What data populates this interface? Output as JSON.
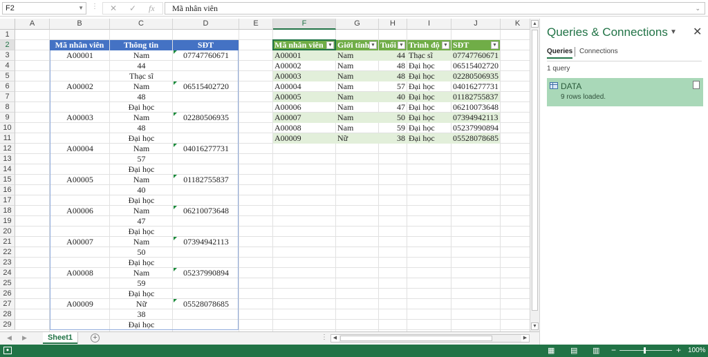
{
  "formula_bar": {
    "name_box": "F2",
    "more_icon": "⋮",
    "cancel_icon": "✕",
    "enter_icon": "✓",
    "fx_icon": "fx",
    "content": "Mã nhân viên"
  },
  "columns": [
    "A",
    "B",
    "C",
    "D",
    "E",
    "F",
    "G",
    "H",
    "I",
    "J",
    "K"
  ],
  "selected_column": "F",
  "rows": [
    "1",
    "2",
    "3",
    "4",
    "5",
    "6",
    "7",
    "8",
    "9",
    "10",
    "11",
    "12",
    "13",
    "14",
    "15",
    "16",
    "17",
    "18",
    "19",
    "20",
    "21",
    "22",
    "23",
    "24",
    "25",
    "26",
    "27",
    "28",
    "29"
  ],
  "selected_row": "2",
  "left_table": {
    "headers": [
      "Mã nhân viên",
      "Thông tin",
      "SĐT"
    ],
    "records": [
      {
        "id": "A00001",
        "gender": "Nam",
        "age": "44",
        "level": "Thạc sĩ",
        "phone": "07747760671"
      },
      {
        "id": "A00002",
        "gender": "Nam",
        "age": "48",
        "level": "Đại học",
        "phone": "06515402720"
      },
      {
        "id": "A00003",
        "gender": "Nam",
        "age": "48",
        "level": "Đại học",
        "phone": "02280506935"
      },
      {
        "id": "A00004",
        "gender": "Nam",
        "age": "57",
        "level": "Đại học",
        "phone": "04016277731"
      },
      {
        "id": "A00005",
        "gender": "Nam",
        "age": "40",
        "level": "Đại học",
        "phone": "01182755837"
      },
      {
        "id": "A00006",
        "gender": "Nam",
        "age": "47",
        "level": "Đại học",
        "phone": "06210073648"
      },
      {
        "id": "A00007",
        "gender": "Nam",
        "age": "50",
        "level": "Đại học",
        "phone": "07394942113"
      },
      {
        "id": "A00008",
        "gender": "Nam",
        "age": "59",
        "level": "Đại học",
        "phone": "05237990894"
      },
      {
        "id": "A00009",
        "gender": "Nữ",
        "age": "38",
        "level": "Đại học",
        "phone": "05528078685"
      }
    ]
  },
  "right_table": {
    "headers": [
      "Mã nhân viên",
      "Giới tính",
      "Tuổi",
      "Trình độ",
      "SĐT"
    ],
    "rows": [
      [
        "A00001",
        "Nam",
        "44",
        "Thạc sĩ",
        "07747760671"
      ],
      [
        "A00002",
        "Nam",
        "48",
        "Đại học",
        "06515402720"
      ],
      [
        "A00003",
        "Nam",
        "48",
        "Đại học",
        "02280506935"
      ],
      [
        "A00004",
        "Nam",
        "57",
        "Đại học",
        "04016277731"
      ],
      [
        "A00005",
        "Nam",
        "40",
        "Đại học",
        "01182755837"
      ],
      [
        "A00006",
        "Nam",
        "47",
        "Đại học",
        "06210073648"
      ],
      [
        "A00007",
        "Nam",
        "50",
        "Đại học",
        "07394942113"
      ],
      [
        "A00008",
        "Nam",
        "59",
        "Đại học",
        "05237990894"
      ],
      [
        "A00009",
        "Nữ",
        "38",
        "Đại học",
        "05528078685"
      ]
    ]
  },
  "sheet_tab": "Sheet1",
  "panel": {
    "title": "Queries & Connections",
    "tabs": [
      "Queries",
      "Connections"
    ],
    "count": "1 query",
    "query": {
      "name": "DATA",
      "status": "9 rows loaded."
    }
  },
  "status_bar": {
    "zoom": "100%"
  },
  "colors": {
    "blue_header": "#4472c4",
    "green_header": "#70ad47",
    "band": "#e2efda",
    "excel_green": "#217346"
  }
}
